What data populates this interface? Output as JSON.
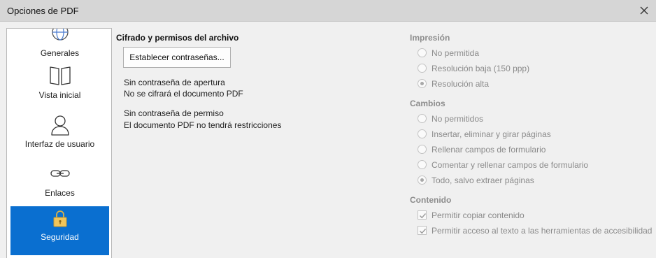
{
  "window": {
    "title": "Opciones de PDF"
  },
  "sidebar": {
    "items": [
      {
        "label": "Generales",
        "icon": "globe-icon"
      },
      {
        "label": "Vista inicial",
        "icon": "book-icon"
      },
      {
        "label": "Interfaz de usuario",
        "icon": "user-icon"
      },
      {
        "label": "Enlaces",
        "icon": "link-icon"
      },
      {
        "label": "Seguridad",
        "icon": "lock-icon",
        "active": true
      }
    ]
  },
  "security": {
    "title": "Cifrado y permisos del archivo",
    "set_passwords_button": "Establecer contraseñas...",
    "open_password_status": "Sin contraseña de apertura",
    "open_password_detail": "No se cifrará el documento PDF",
    "permission_password_status": "Sin contraseña de permiso",
    "permission_password_detail": "El documento PDF no tendrá restricciones"
  },
  "printing": {
    "title": "Impresión",
    "options": [
      {
        "label": "No permitida",
        "selected": false
      },
      {
        "label": "Resolución baja (150 ppp)",
        "selected": false
      },
      {
        "label": "Resolución alta",
        "selected": true
      }
    ]
  },
  "changes": {
    "title": "Cambios",
    "options": [
      {
        "label": "No permitidos",
        "selected": false
      },
      {
        "label": "Insertar, eliminar y girar páginas",
        "selected": false
      },
      {
        "label": "Rellenar campos de formulario",
        "selected": false
      },
      {
        "label": "Comentar y rellenar campos de formulario",
        "selected": false
      },
      {
        "label": "Todo, salvo extraer páginas",
        "selected": true
      }
    ]
  },
  "content": {
    "title": "Contenido",
    "options": [
      {
        "label": "Permitir copiar contenido",
        "checked": true
      },
      {
        "label": "Permitir acceso al texto a las herramientas de accesibilidad",
        "checked": true
      }
    ]
  },
  "colors": {
    "accent": "#0a6fd0",
    "disabled_text": "#8a8a8a"
  }
}
